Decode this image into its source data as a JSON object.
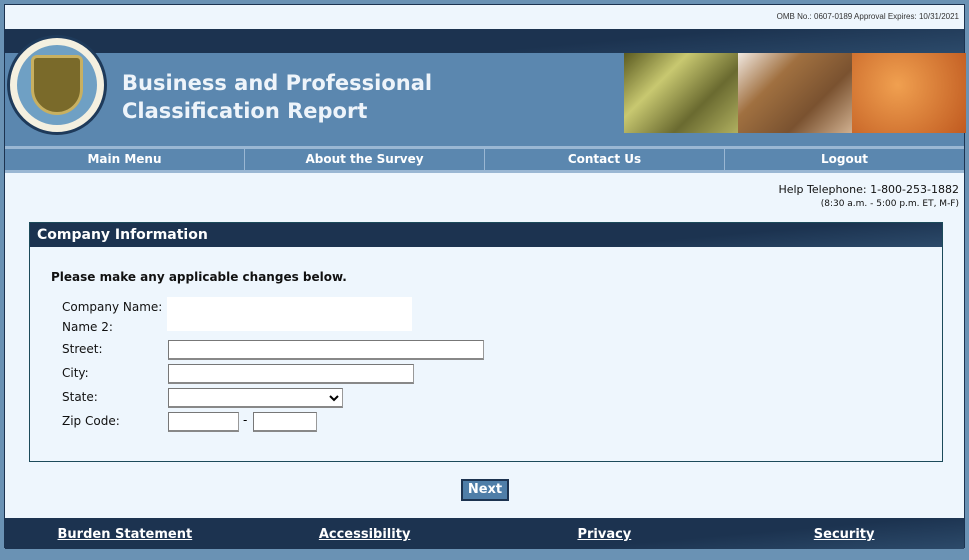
{
  "omb": "OMB No.: 0607-0189 Approval Expires: 10/31/2021",
  "header": {
    "title_line1": "Business and Professional",
    "title_line2": "Classification Report",
    "seal_text": "U.S. DEPARTMENT OF COMMERCE · BUREAU OF THE CENSUS"
  },
  "nav": [
    "Main Menu",
    "About the Survey",
    "Contact Us",
    "Logout"
  ],
  "help": {
    "phone": "Help Telephone: 1-800-253-1882",
    "hours": "(8:30 a.m. - 5:00 p.m. ET, M-F)"
  },
  "form": {
    "title": "Company Information",
    "intro": "Please make any applicable changes below.",
    "labels": {
      "company": "Company Name:",
      "name2": "Name 2:",
      "street": "Street:",
      "city": "City:",
      "state": "State:",
      "zip": "Zip Code:"
    },
    "values": {
      "street": "",
      "city": "",
      "state": "",
      "zip": "",
      "zip4": ""
    },
    "dash": "-"
  },
  "next_label": "Next",
  "footer": [
    "Burden Statement",
    "Accessibility",
    "Privacy",
    "Security"
  ]
}
